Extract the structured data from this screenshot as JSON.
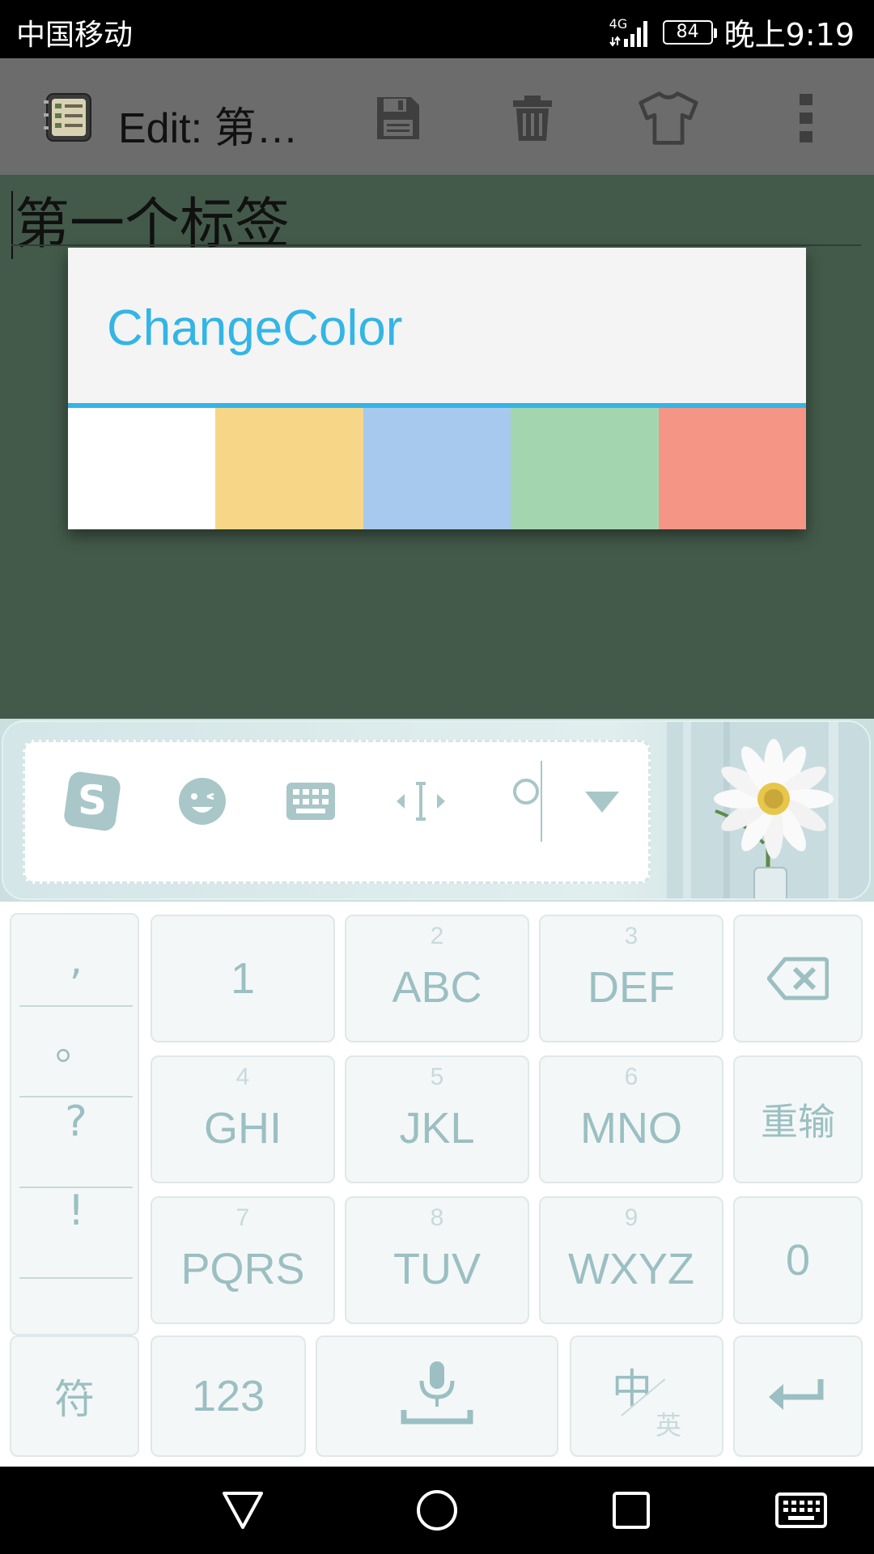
{
  "status_bar": {
    "carrier": "中国移动",
    "network": "4G",
    "battery": "84",
    "time": "晚上9:19"
  },
  "app_bar": {
    "title": "Edit: 第…",
    "icons": [
      "app-notes-icon",
      "save-icon",
      "trash-icon",
      "shirt-icon",
      "more-vert-icon"
    ]
  },
  "editor": {
    "text": "第一个标签"
  },
  "dialog": {
    "title": "ChangeColor",
    "swatches": [
      {
        "name": "white",
        "color": "#ffffff"
      },
      {
        "name": "yellow",
        "color": "#f7d787"
      },
      {
        "name": "blue",
        "color": "#a8c9ee"
      },
      {
        "name": "green",
        "color": "#a3d6ae"
      },
      {
        "name": "red",
        "color": "#f49585"
      }
    ]
  },
  "ime_toolbar": {
    "icons": [
      "sogou-logo-icon",
      "emoji-icon",
      "keyboard-icon",
      "cursor-move-icon",
      "search-icon",
      "collapse-down-icon"
    ]
  },
  "keyboard": {
    "punctuation": [
      ",",
      "。",
      "?",
      "!"
    ],
    "keys": {
      "k1": {
        "main": "1"
      },
      "k2": {
        "num": "2",
        "main": "ABC"
      },
      "k3": {
        "num": "3",
        "main": "DEF"
      },
      "k4": {
        "num": "4",
        "main": "GHI"
      },
      "k5": {
        "num": "5",
        "main": "JKL"
      },
      "k6": {
        "num": "6",
        "main": "MNO"
      },
      "k7": {
        "num": "7",
        "main": "PQRS"
      },
      "k8": {
        "num": "8",
        "main": "TUV"
      },
      "k9": {
        "num": "9",
        "main": "WXYZ"
      },
      "k0": {
        "main": "0"
      },
      "retype": "重输",
      "symbol": "符",
      "numeric": "123",
      "lang_main": "中",
      "lang_sub": "英"
    }
  },
  "nav_bar": {
    "icons": [
      "back-triangle-icon",
      "home-circle-icon",
      "recents-square-icon",
      "keyboard-toggle-icon"
    ]
  },
  "colors": {
    "accent": "#33b5e5",
    "editor_bg": "#435a4a",
    "key_text": "#9bbfc2"
  }
}
